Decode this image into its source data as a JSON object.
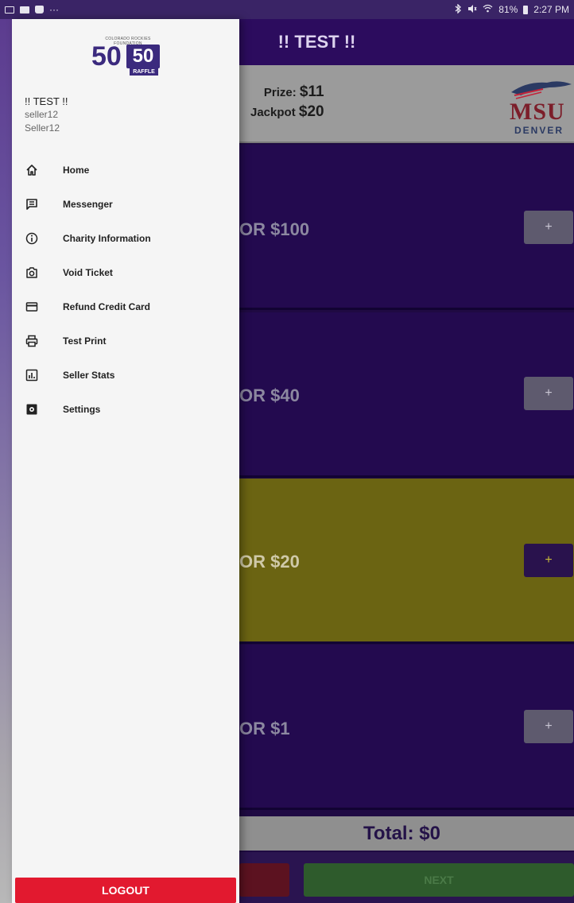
{
  "status_bar": {
    "left_dots": "···",
    "right_text": "81%",
    "time": "2:27 PM",
    "icons": [
      "image-icon",
      "news-icon",
      "bag-icon",
      "bluetooth-icon",
      "mute-icon",
      "wifi-icon",
      "battery-icon"
    ]
  },
  "app": {
    "title": "!! TEST !!",
    "prize_label": "Prize:",
    "prize_value": "$11",
    "jackpot_label": "Jackpot",
    "jackpot_value": "$20",
    "sponsor_logo_text": "MSU",
    "sponsor_logo_sub": "DENVER",
    "tickets": [
      {
        "label": "OR $100",
        "button": "+"
      },
      {
        "label": "OR $40",
        "button": "+"
      },
      {
        "label": "OR $20",
        "button": "+",
        "highlighted": true
      },
      {
        "label": "OR $1",
        "button": "+"
      }
    ],
    "total": "Total: $0",
    "next_label": "NEXT"
  },
  "drawer": {
    "logo": {
      "top_text": "COLORADO ROCKIES FOUNDATION",
      "left": "50",
      "right": "50",
      "bottom": "RAFFLE"
    },
    "user": {
      "name": "!! TEST !!",
      "line1": "seller12",
      "line2": "Seller12"
    },
    "menu": [
      {
        "label": "Home",
        "icon": "home-icon"
      },
      {
        "label": "Messenger",
        "icon": "message-icon"
      },
      {
        "label": "Charity Information",
        "icon": "info-icon"
      },
      {
        "label": "Void Ticket",
        "icon": "camera-icon"
      },
      {
        "label": "Refund Credit Card",
        "icon": "credit-card-icon"
      },
      {
        "label": "Test Print",
        "icon": "printer-icon"
      },
      {
        "label": "Seller Stats",
        "icon": "stats-icon"
      },
      {
        "label": "Settings",
        "icon": "settings-icon"
      }
    ],
    "logout_label": "LOGOUT"
  },
  "colors": {
    "header_purple": "#2c0c5e",
    "ticket_purple": "#230a4f",
    "ticket_highlight": "#6b6412",
    "logout_red": "#e2192f",
    "brand_purple": "#3b2a7e"
  }
}
